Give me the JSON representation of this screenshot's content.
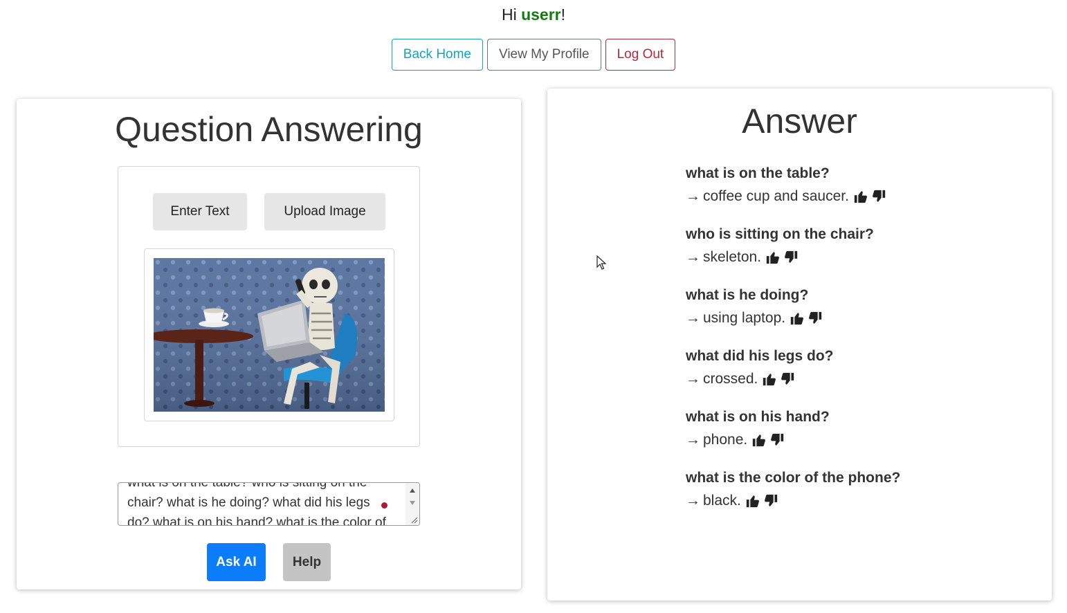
{
  "header": {
    "greeting_prefix": "Hi ",
    "username": "userr",
    "greeting_suffix": "!"
  },
  "nav": {
    "back_home": "Back Home",
    "view_profile": "View My Profile",
    "log_out": "Log Out"
  },
  "left_panel": {
    "title": "Question Answering",
    "tab_enter_text": "Enter Text",
    "tab_upload_image": "Upload Image",
    "question_text": "what is on the table? who is sitting on the chair? what is he doing? what did his legs do? what is on his hand? what is the color of the phone?",
    "ask_button": "Ask AI",
    "help_button": "Help"
  },
  "right_panel": {
    "title": "Answer",
    "items": [
      {
        "q": "what is on the table?",
        "a": "coffee cup and saucer."
      },
      {
        "q": "who is sitting on the chair?",
        "a": "skeleton."
      },
      {
        "q": "what is he doing?",
        "a": "using laptop."
      },
      {
        "q": "what did his legs do?",
        "a": "crossed."
      },
      {
        "q": "what is on his hand?",
        "a": "phone."
      },
      {
        "q": "what is the color of the phone?",
        "a": "black."
      }
    ],
    "arrow": "→"
  },
  "colors": {
    "username": "#137a13",
    "back_home": "#17a2b8",
    "log_out": "#b02a37",
    "ask_button_bg": "#0b7dfa",
    "help_button_bg": "#c4c4c4"
  },
  "icons": {
    "like": "thumbs-up-icon",
    "dislike": "thumbs-down-icon",
    "cursor": "mouse-cursor-icon"
  }
}
